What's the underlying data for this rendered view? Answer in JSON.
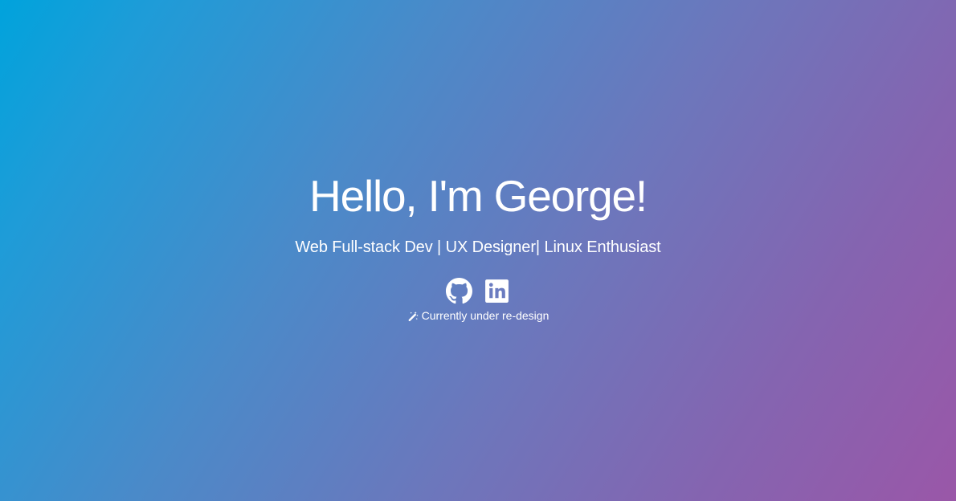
{
  "hero": {
    "title": "Hello, I'm George!",
    "subtitle": "Web Full-stack Dev | UX Designer| Linux Enthusiast",
    "socials": [
      {
        "icon": "github-icon",
        "label": "GitHub"
      },
      {
        "icon": "linkedin-icon",
        "label": "LinkedIn"
      }
    ],
    "status_icon": "magic-wand-icon",
    "status_text": "Currently under re-design"
  },
  "colors": {
    "gradient_start": "#00a3dc",
    "gradient_end": "#9a57a8",
    "text": "#ffffff"
  }
}
